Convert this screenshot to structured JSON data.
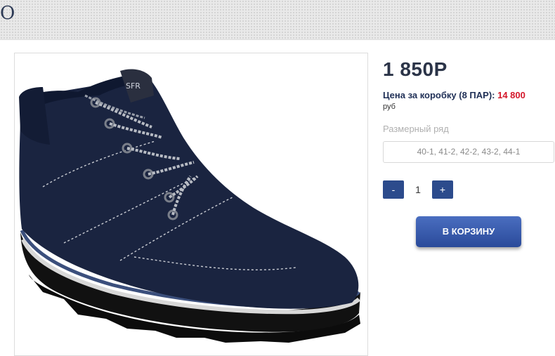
{
  "header": {
    "title": "O"
  },
  "product": {
    "image_alt": "boot-image",
    "price": "1 850Р",
    "box_price_label": "Цена за коробку (8 ПАР):",
    "box_price_value": "14 800",
    "currency": "руб",
    "size_label": "Размерный ряд",
    "size_value": "40-1, 41-2, 42-2, 43-2, 44-1",
    "quantity": "1",
    "minus_label": "-",
    "plus_label": "+",
    "cart_label": "В КОРЗИНУ",
    "boot_brand_text": "SFR"
  },
  "colors": {
    "accent": "#2c4b8c",
    "price_red": "#d4172a"
  }
}
